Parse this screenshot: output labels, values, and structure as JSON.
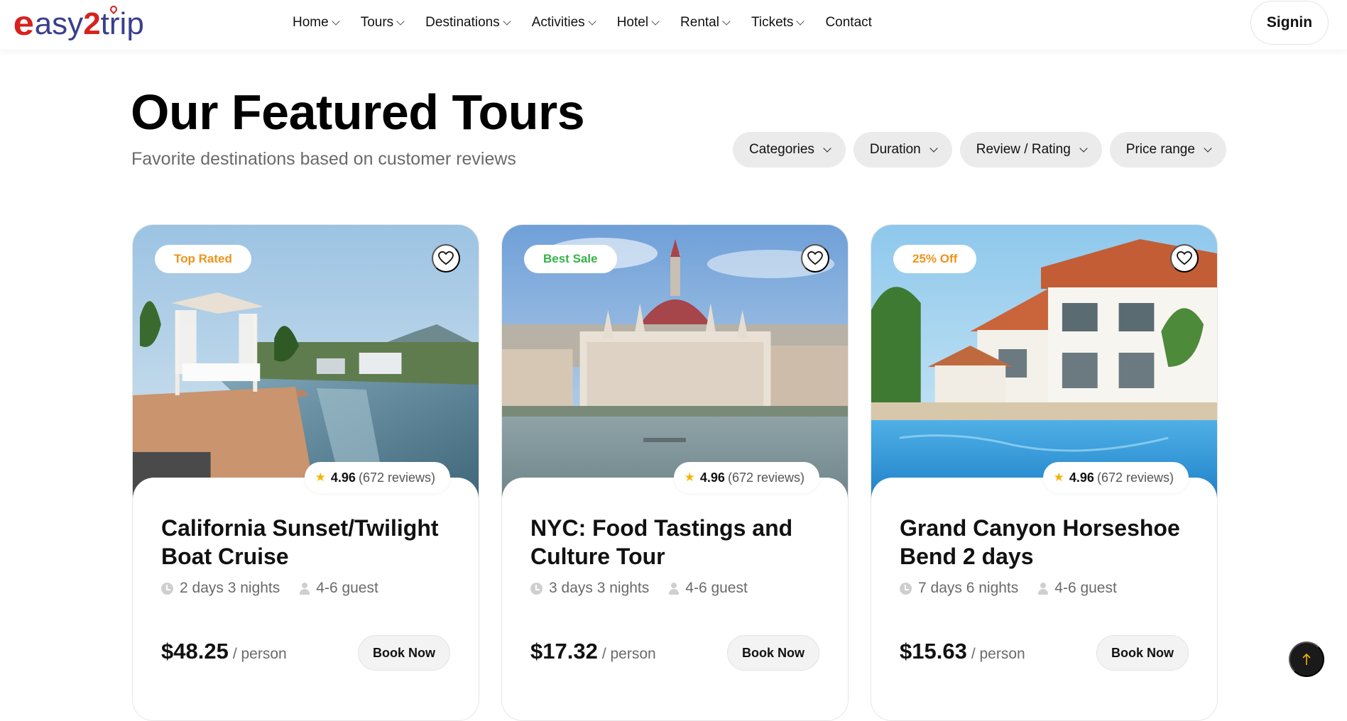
{
  "brand": {
    "logo_e": "e",
    "logo_asy": "asy",
    "logo_two": "2",
    "logo_trip": "trip"
  },
  "nav": {
    "items": [
      {
        "label": "Home",
        "dropdown": true
      },
      {
        "label": "Tours",
        "dropdown": true
      },
      {
        "label": "Destinations",
        "dropdown": true
      },
      {
        "label": "Activities",
        "dropdown": true
      },
      {
        "label": "Hotel",
        "dropdown": true
      },
      {
        "label": "Rental",
        "dropdown": true
      },
      {
        "label": "Tickets",
        "dropdown": true
      },
      {
        "label": "Contact",
        "dropdown": false
      }
    ],
    "signin_label": "Signin"
  },
  "section": {
    "title": "Our Featured Tours",
    "subtitle": "Favorite destinations based on customer reviews",
    "filters": [
      "Categories",
      "Duration",
      "Review / Rating",
      "Price range"
    ]
  },
  "cards": [
    {
      "badge": "Top Rated",
      "badge_color": "#f0931b",
      "rating_score": "4.96",
      "rating_count": "(672 reviews)",
      "title": "California Sunset/Twilight Boat Cruise",
      "duration": "2 days 3 nights",
      "guests": "4-6 guest",
      "price": "$48.25",
      "per": "/ person",
      "book_label": "Book Now",
      "image": "rooftop-pool-cabana"
    },
    {
      "badge": "Best Sale",
      "badge_color": "#34b249",
      "rating_score": "4.96",
      "rating_count": "(672 reviews)",
      "title": "NYC: Food Tastings and Culture Tour",
      "duration": "3 days 3 nights",
      "guests": "4-6 guest",
      "price": "$17.32",
      "per": "/ person",
      "book_label": "Book Now",
      "image": "parliament-building-river"
    },
    {
      "badge": "25% Off",
      "badge_color": "#f0931b",
      "rating_score": "4.96",
      "rating_count": "(672 reviews)",
      "title": "Grand Canyon Horseshoe Bend 2 days",
      "duration": "7 days 6 nights",
      "guests": "4-6 guest",
      "price": "$15.63",
      "per": "/ person",
      "book_label": "Book Now",
      "image": "resort-villas-pool"
    }
  ],
  "icons": {
    "star": "star-icon",
    "heart": "heart-icon",
    "clock": "clock-icon",
    "user": "user-icon",
    "arrow_up": "arrow-up-icon"
  },
  "colors": {
    "accent_yellow": "#f5b400",
    "chip_bg": "#ebebeb",
    "back_to_top": "#1a1a1a"
  }
}
